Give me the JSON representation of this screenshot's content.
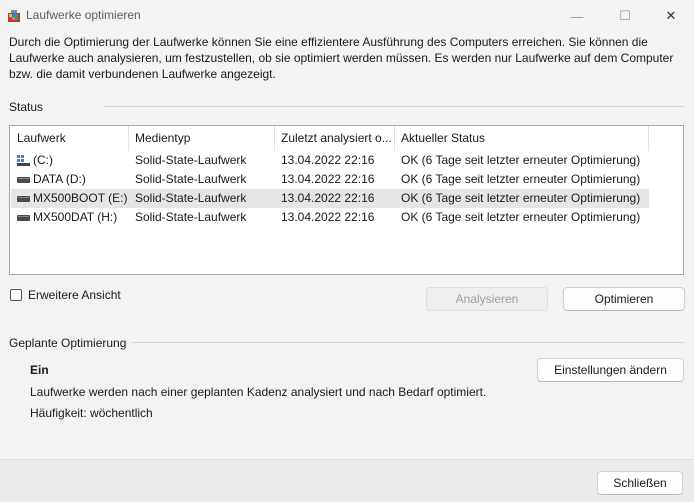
{
  "window": {
    "title": "Laufwerke optimieren",
    "controls": {
      "minimize": "—",
      "maximize": "☐",
      "close": "✕"
    }
  },
  "description": "Durch die Optimierung der Laufwerke können Sie eine effizientere Ausführung des Computers erreichen. Sie können die Laufwerke auch analysieren, um festzustellen, ob sie optimiert werden müssen. Es werden nur Laufwerke auf dem Computer bzw. die damit verbundenen Laufwerke angezeigt.",
  "status": {
    "label": "Status",
    "columns": [
      "Laufwerk",
      "Medientyp",
      "Zuletzt analysiert o...",
      "Aktueller Status"
    ],
    "drives": [
      {
        "icon": "windows-drive-icon",
        "name": "(C:)",
        "media": "Solid-State-Laufwerk",
        "last": "13.04.2022 22:16",
        "state": "OK (6 Tage seit letzter erneuter Optimierung)"
      },
      {
        "icon": "drive-icon",
        "name": "DATA (D:)",
        "media": "Solid-State-Laufwerk",
        "last": "13.04.2022 22:16",
        "state": "OK (6 Tage seit letzter erneuter Optimierung)"
      },
      {
        "icon": "drive-icon",
        "name": "MX500BOOT (E:)",
        "media": "Solid-State-Laufwerk",
        "last": "13.04.2022 22:16",
        "state": "OK (6 Tage seit letzter erneuter Optimierung)"
      },
      {
        "icon": "drive-icon",
        "name": "MX500DAT (H:)",
        "media": "Solid-State-Laufwerk",
        "last": "13.04.2022 22:16",
        "state": "OK (6 Tage seit letzter erneuter Optimierung)"
      }
    ],
    "selected_index": 2,
    "extended_view_label": "Erweitere Ansicht",
    "extended_view_checked": false,
    "analyze_label": "Analysieren",
    "analyze_enabled": false,
    "optimize_label": "Optimieren"
  },
  "scheduled": {
    "label": "Geplante Optimierung",
    "state": "Ein",
    "description": "Laufwerke werden nach einer geplanten Kadenz analysiert und nach Bedarf optimiert.",
    "frequency": "Häufigkeit: wöchentlich",
    "settings_label": "Einstellungen ändern"
  },
  "footer": {
    "close_label": "Schließen"
  }
}
